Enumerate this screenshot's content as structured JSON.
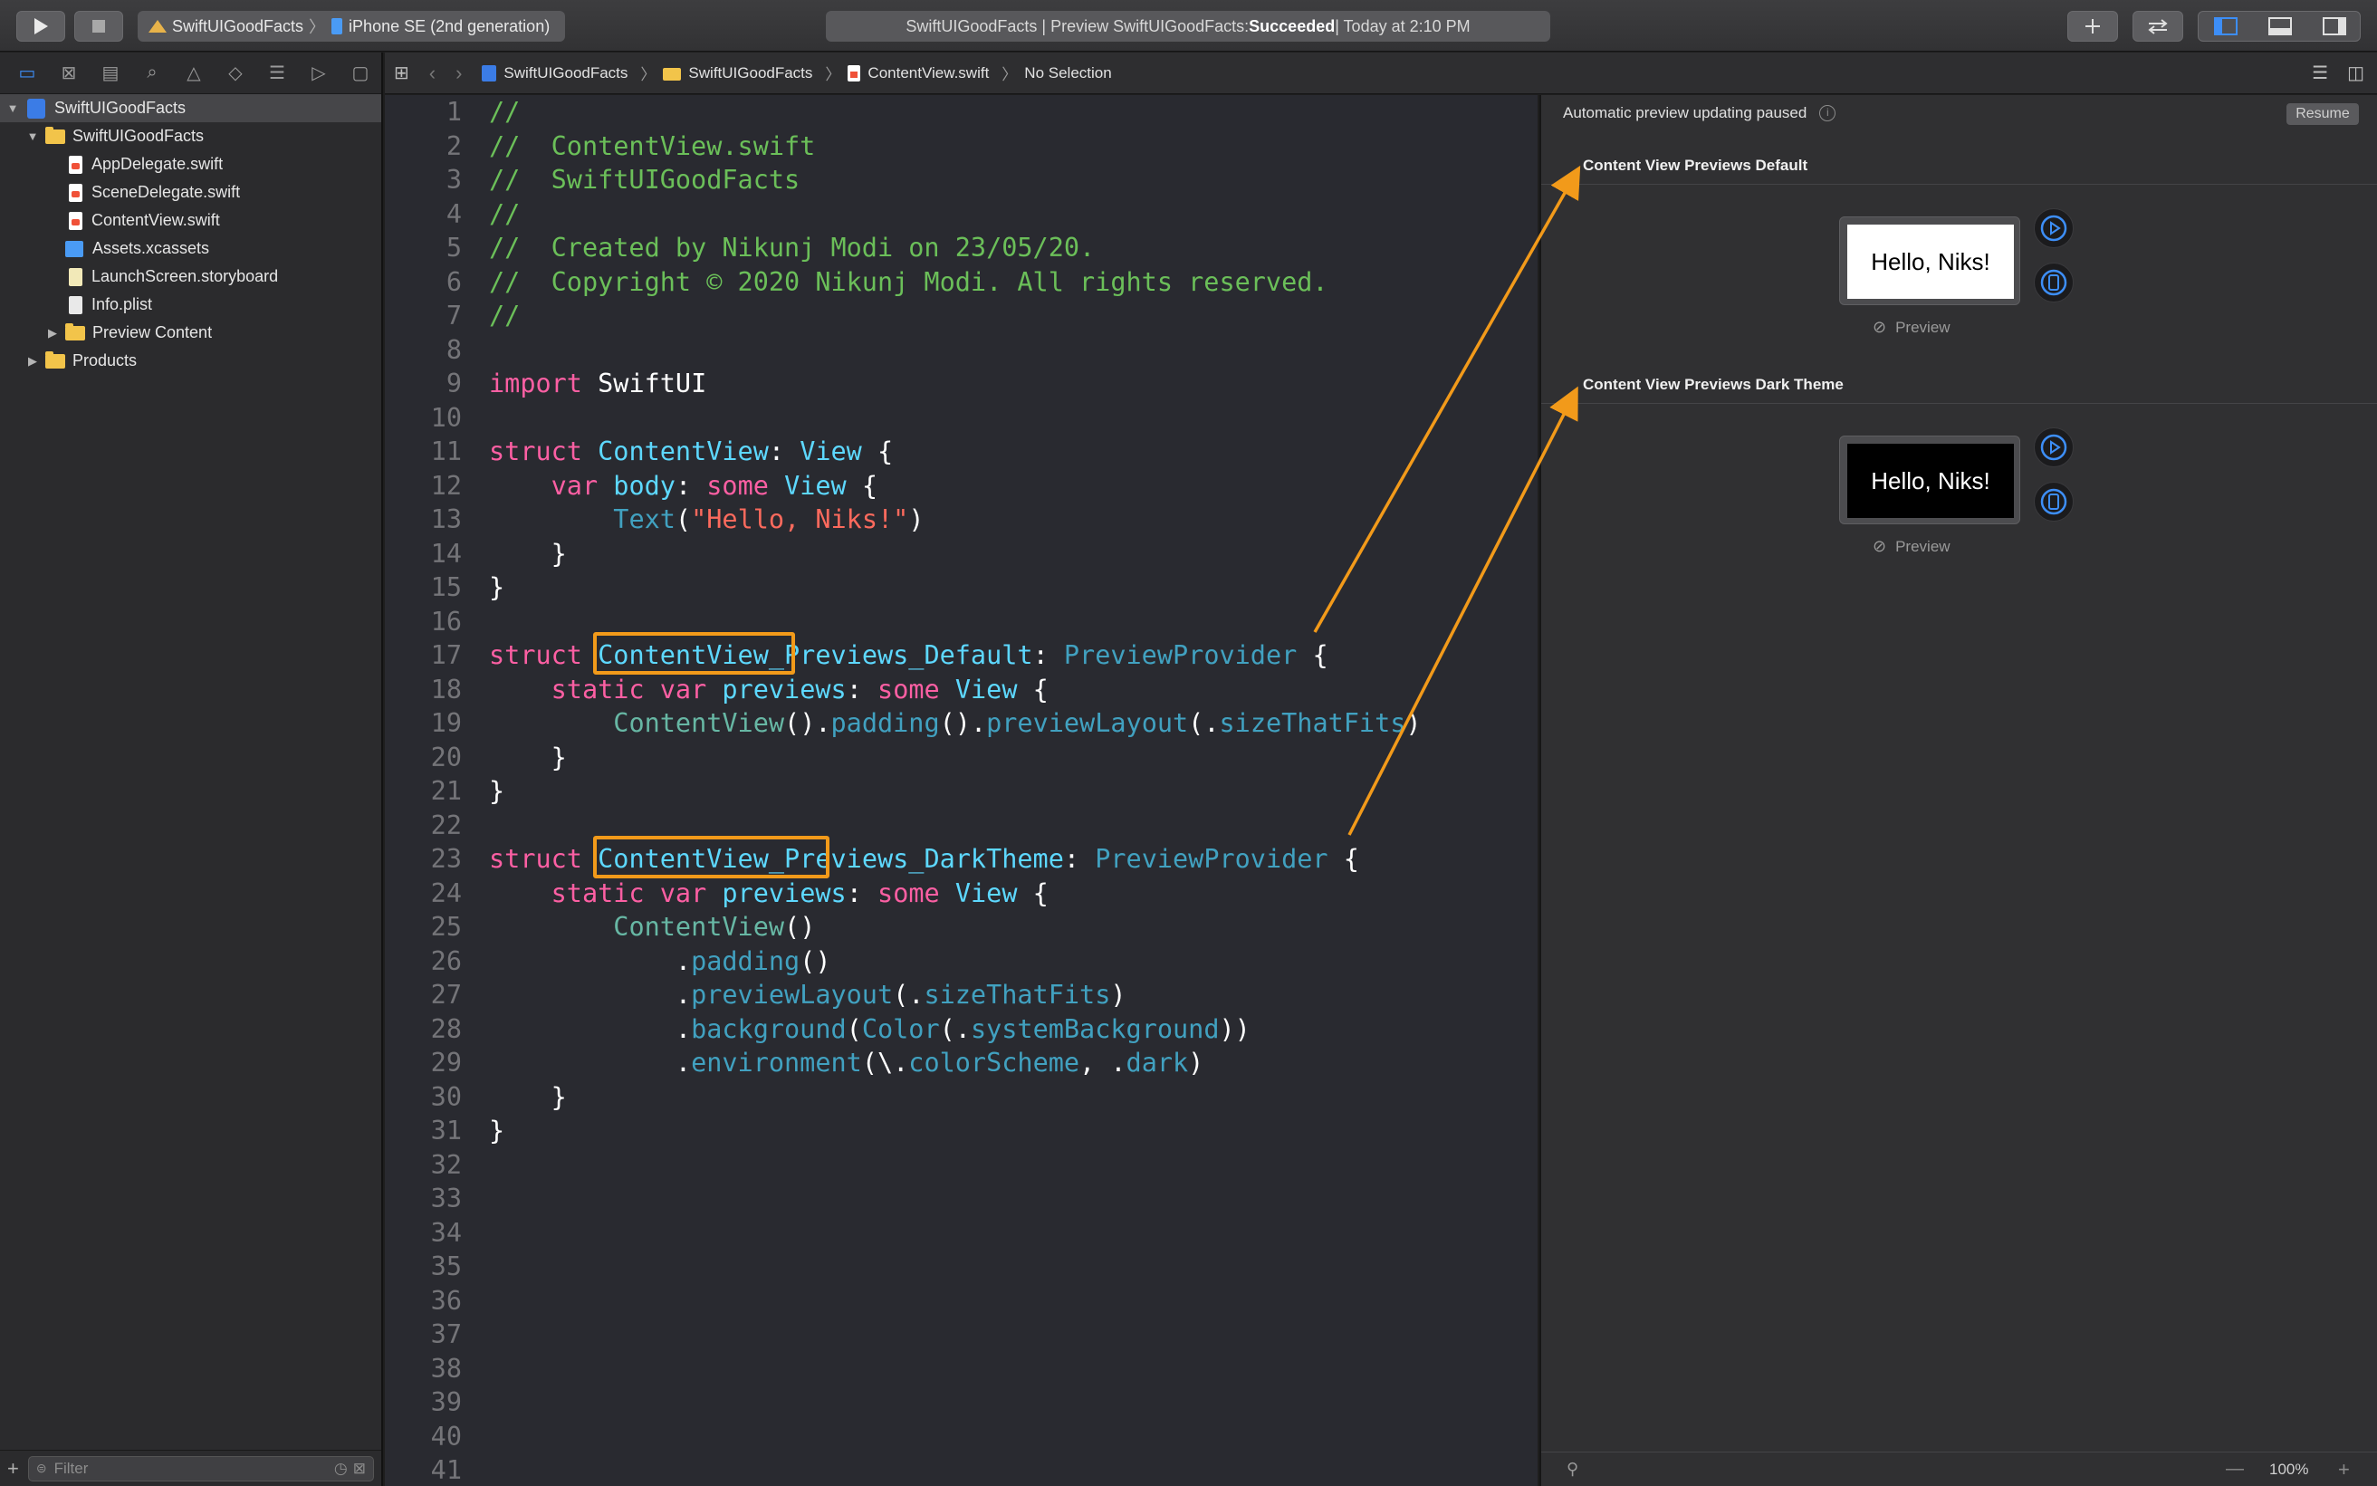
{
  "toolbar": {
    "scheme_project": "SwiftUIGoodFacts",
    "scheme_device": "iPhone SE (2nd generation)",
    "activity_prefix": "SwiftUIGoodFacts | Preview SwiftUIGoodFacts: ",
    "activity_status": "Succeeded",
    "activity_suffix": " | Today at 2:10 PM"
  },
  "navigator": {
    "items": [
      {
        "label": "SwiftUIGoodFacts",
        "kind": "project"
      },
      {
        "label": "SwiftUIGoodFacts",
        "kind": "folder"
      },
      {
        "label": "AppDelegate.swift",
        "kind": "swift"
      },
      {
        "label": "SceneDelegate.swift",
        "kind": "swift"
      },
      {
        "label": "ContentView.swift",
        "kind": "swift"
      },
      {
        "label": "Assets.xcassets",
        "kind": "assets"
      },
      {
        "label": "LaunchScreen.storyboard",
        "kind": "storyboard"
      },
      {
        "label": "Info.plist",
        "kind": "plist"
      },
      {
        "label": "Preview Content",
        "kind": "folder"
      },
      {
        "label": "Products",
        "kind": "folder"
      }
    ],
    "filter_placeholder": "Filter"
  },
  "jumpbar": {
    "crumbs": [
      "SwiftUIGoodFacts",
      "SwiftUIGoodFacts",
      "ContentView.swift",
      "No Selection"
    ]
  },
  "editor": {
    "line_numbers": [
      "1",
      "2",
      "3",
      "4",
      "5",
      "6",
      "7",
      "8",
      "9",
      "10",
      "11",
      "12",
      "13",
      "14",
      "15",
      "16",
      "17",
      "18",
      "19",
      "20",
      "21",
      "22",
      "23",
      "24",
      "25",
      "26",
      "27",
      "28",
      "29",
      "30",
      "31",
      "32",
      "33",
      "34",
      "35",
      "36",
      "37",
      "38",
      "39",
      "40",
      "41"
    ],
    "lines": {
      "l1": "//",
      "l2": "//  ContentView.swift",
      "l3": "//  SwiftUIGoodFacts",
      "l4": "//",
      "l5": "//  Created by Nikunj Modi on 23/05/20.",
      "l6": "//  Copyright © 2020 Nikunj Modi. All rights reserved.",
      "l7": "//",
      "kw_import": "import",
      "swiftui": "SwiftUI",
      "kw_struct": "struct",
      "contentview": "ContentView",
      "view": "View",
      "kw_var": "var",
      "body": "body",
      "kw_some": "some",
      "text_fn": "Text",
      "hello_str": "\"Hello, Niks!\"",
      "previews_default": "ContentView_Previews_Default",
      "preview_provider": "PreviewProvider",
      "kw_static": "static",
      "previews": "previews",
      "padding": "padding",
      "preview_layout": "previewLayout",
      "size_that_fits": "sizeThatFits",
      "previews_dark": "ContentView_Previews_DarkTheme",
      "background": "background",
      "color": "Color",
      "system_background": "systemBackground",
      "environment": "environment",
      "color_scheme": "colorScheme",
      "dark": "dark"
    }
  },
  "canvas": {
    "status": "Automatic preview updating paused",
    "resume_label": "Resume",
    "groups": [
      {
        "title": "Content View Previews Default",
        "screen_text": "Hello, Niks!",
        "preview_label": "Preview",
        "screen_bg": "#ffffff",
        "screen_fg": "#000000"
      },
      {
        "title": "Content View Previews Dark Theme",
        "screen_text": "Hello, Niks!",
        "preview_label": "Preview",
        "screen_bg": "#000000",
        "screen_fg": "#ffffff"
      }
    ],
    "zoom": "100%"
  },
  "colors": {
    "highlight": "#f29a1a",
    "accent": "#3d8ef7"
  }
}
